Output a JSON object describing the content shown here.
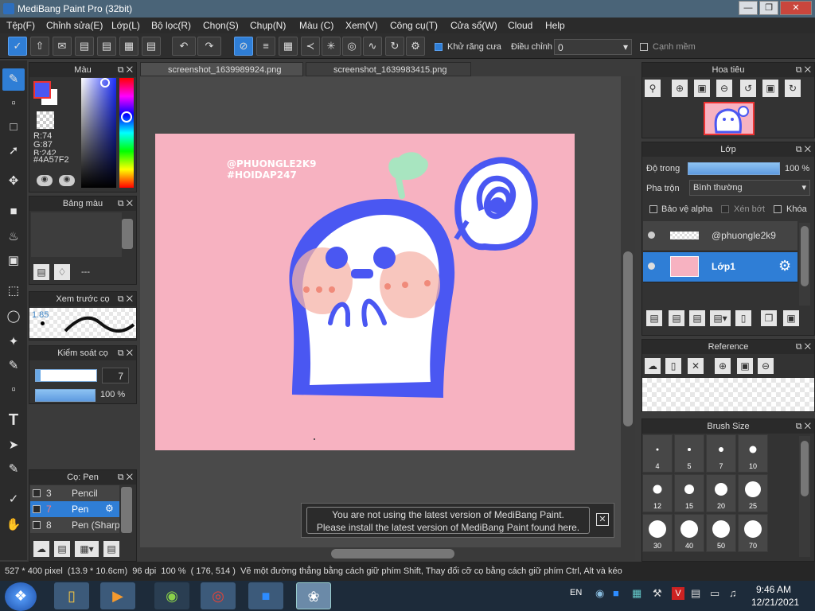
{
  "app": {
    "title": "MediBang Paint Pro (32bit)"
  },
  "menu": [
    "Tệp(F)",
    "Chỉnh sửa(E)",
    "Lớp(L)",
    "Bộ lọc(R)",
    "Chọn(S)",
    "Chụp(N)",
    "Màu (C)",
    "Xem(V)",
    "Công cụ(T)",
    "Cửa sổ(W)",
    "Cloud",
    "Help"
  ],
  "toolbar": {
    "antialias": "Khử răng cưa",
    "adjust": "Điều chỉnh",
    "adjust_value": "0",
    "smooth": "Cạnh mềm"
  },
  "tabs": [
    "screenshot_1639989924.png",
    "screenshot_1639983415.png"
  ],
  "color_panel": {
    "title": "Màu",
    "r": "R:74",
    "g": "G:87",
    "b": "B:242",
    "hex": "#4A57F2"
  },
  "palette_panel": {
    "title": "Bảng màu",
    "value": "---"
  },
  "brush_preview": {
    "title": "Xem trước cọ",
    "size": "1.85"
  },
  "brush_control": {
    "title": "Kiểm soát cọ",
    "size": "7",
    "opacity": "100 %"
  },
  "brush_panel": {
    "title": "Cọ: Pen",
    "items": [
      {
        "num": "3",
        "name": "Pencil"
      },
      {
        "num": "7",
        "name": "Pen"
      },
      {
        "num": "8",
        "name": "Pen (Sharp"
      }
    ]
  },
  "navigator": {
    "title": "Hoa tiêu"
  },
  "layer_panel": {
    "title": "Lớp",
    "opacity_label": "Độ trong",
    "opacity_value": "100 %",
    "opacity": 1.0,
    "blend_label": "Pha trộn",
    "blend_value": "Bình thường",
    "protect_alpha": "Bảo vệ alpha",
    "clip": "Xén bớt",
    "lock": "Khóa",
    "layers": [
      {
        "name": "@phuongle2k9"
      },
      {
        "name": "Lớp1"
      }
    ]
  },
  "reference": {
    "title": "Reference"
  },
  "brush_size": {
    "title": "Brush Size",
    "sizes": [
      "4",
      "5",
      "7",
      "10",
      "12",
      "15",
      "20",
      "25",
      "30",
      "40",
      "50",
      "70"
    ]
  },
  "canvas": {
    "text1": "@PHUONGLE2K9",
    "text2": "#HOIDAP247"
  },
  "notification": {
    "line1": "You are not using the latest version of MediBang Paint.",
    "line2": "Please install the latest version of MediBang Paint found here."
  },
  "status": {
    "size": "527 * 400 pixel",
    "cm": "(13.9 * 10.6cm)",
    "dpi": "96 dpi",
    "zoom": "100 %",
    "coords": "( 176, 514 )",
    "hint": "Vẽ một đường thẳng bằng cách giữ phím Shift, Thay đổi cỡ cọ bằng cách giữ phím Ctrl, Alt và kéo"
  },
  "taskbar": {
    "lang": "EN",
    "time": "9:46 AM",
    "date": "12/21/2021"
  },
  "colors": {
    "accent": "#2f7ed6",
    "fg": "#4A57F2",
    "paper": "#f7b2c1"
  }
}
